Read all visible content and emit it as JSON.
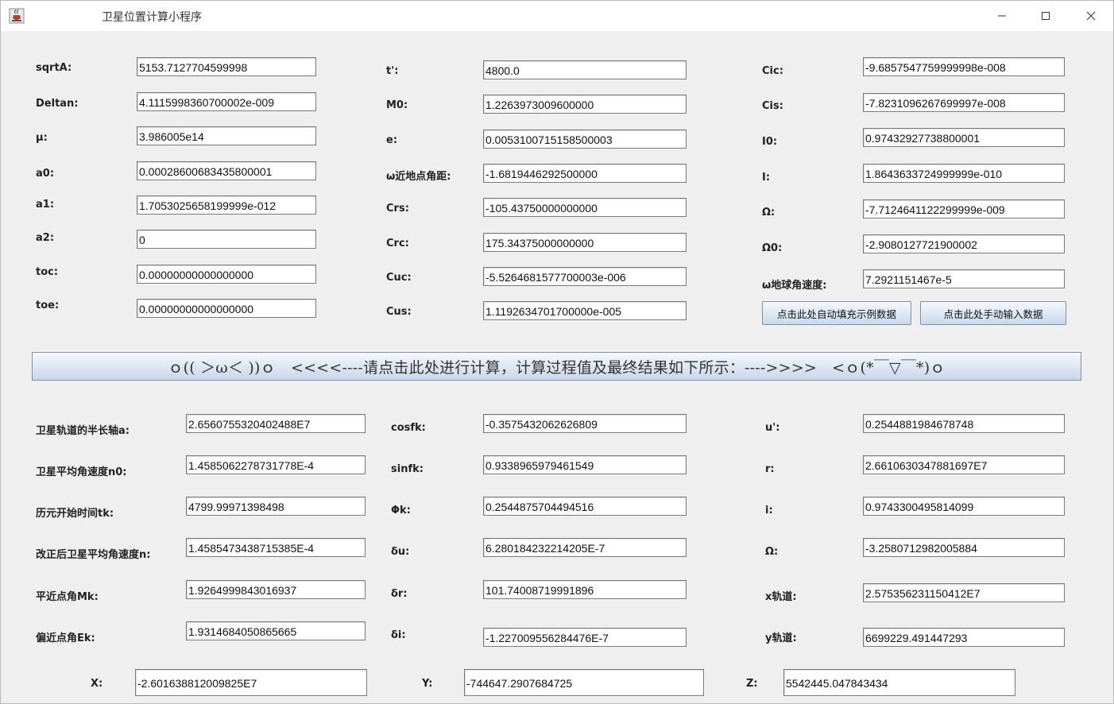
{
  "window": {
    "title": "卫星位置计算小程序",
    "icon": "java-cup-icon",
    "controls": [
      "minimize-icon",
      "maximize-icon",
      "close-icon"
    ]
  },
  "inputs": {
    "col1": [
      {
        "label": "sqrtA:",
        "value": "5153.7127704599998"
      },
      {
        "label": "Deltan:",
        "value": "4.1115998360700002e-009"
      },
      {
        "label": "μ:",
        "value": "3.986005e14"
      },
      {
        "label": "a0:",
        "value": "0.00028600683435800001"
      },
      {
        "label": "a1:",
        "value": "1.7053025658199999e-012"
      },
      {
        "label": "a2:",
        "value": "0"
      },
      {
        "label": "toc:",
        "value": "0.00000000000000000"
      },
      {
        "label": "toe:",
        "value": "0.00000000000000000"
      }
    ],
    "col2": [
      {
        "label": "t':",
        "value": "4800.0"
      },
      {
        "label": "M0:",
        "value": "1.2263973009600000"
      },
      {
        "label": "e:",
        "value": "0.0053100715158500003"
      },
      {
        "label": "ω近地点角距:",
        "value": "-1.6819446292500000"
      },
      {
        "label": "Crs:",
        "value": "-105.43750000000000"
      },
      {
        "label": "Crc:",
        "value": "175.34375000000000"
      },
      {
        "label": "Cuc:",
        "value": "-5.5264681577700003e-006"
      },
      {
        "label": "Cus:",
        "value": "1.1192634701700000e-005"
      }
    ],
    "col3": [
      {
        "label": "Cic:",
        "value": "-9.6857547759999998e-008"
      },
      {
        "label": "Cis:",
        "value": "-7.8231096267699997e-008"
      },
      {
        "label": "I0:",
        "value": "0.97432927738800001"
      },
      {
        "label": "I:",
        "value": "1.8643633724999999e-010"
      },
      {
        "label": "Ω:",
        "value": "-7.7124641122299999e-009"
      },
      {
        "label": "Ω0:",
        "value": "-2.9080127721900002"
      },
      {
        "label": "ω地球角速度:",
        "value": "7.2921151467e-5"
      }
    ]
  },
  "buttons": {
    "autofill": "点击此处自动填充示例数据",
    "manual": "点击此处手动输入数据",
    "calculate": "ｏ(( ＞ω＜ ))ｏ　<<<<----请点击此处进行计算，计算过程值及最终结果如下所示：---->>>>　<ｏ(*￣▽￣*)ｏ"
  },
  "results": {
    "col1": [
      {
        "label": "卫星轨道的半长轴a:",
        "value": "2.6560755320402488E7"
      },
      {
        "label": "卫星平均角速度n0:",
        "value": "1.4585062278731778E-4"
      },
      {
        "label": "历元开始时间tk:",
        "value": "4799.99971398498"
      },
      {
        "label": "改正后卫星平均角速度n:",
        "value": "1.4585473438715385E-4"
      },
      {
        "label": "平近点角Mk:",
        "value": "1.9264999843016937"
      },
      {
        "label": "偏近点角Ek:",
        "value": "1.9314684050865665"
      }
    ],
    "col2": [
      {
        "label": "cosfk:",
        "value": "-0.3575432062626809"
      },
      {
        "label": "sinfk:",
        "value": "0.9338965979461549"
      },
      {
        "label": "Φk:",
        "value": "0.2544875704494516"
      },
      {
        "label": "δu:",
        "value": "6.280184232214205E-7"
      },
      {
        "label": "δr:",
        "value": "101.74008719991896"
      },
      {
        "label": "δi:",
        "value": "-1.227009556284476E-7"
      }
    ],
    "col3": [
      {
        "label": "u':",
        "value": "0.2544881984678748"
      },
      {
        "label": "r:",
        "value": "2.6610630347881697E7"
      },
      {
        "label": "i:",
        "value": "0.9743300495814099"
      },
      {
        "label": "Ω:",
        "value": "-3.2580712982005884"
      },
      {
        "label": "x轨道:",
        "value": "2.575356231150412E7"
      },
      {
        "label": "y轨道:",
        "value": "6699229.491447293"
      }
    ]
  },
  "final": [
    {
      "label": "X:",
      "value": "-2.601638812009825E7"
    },
    {
      "label": "Y:",
      "value": "-744647.2907684725"
    },
    {
      "label": "Z:",
      "value": "5542445.047843434"
    }
  ]
}
